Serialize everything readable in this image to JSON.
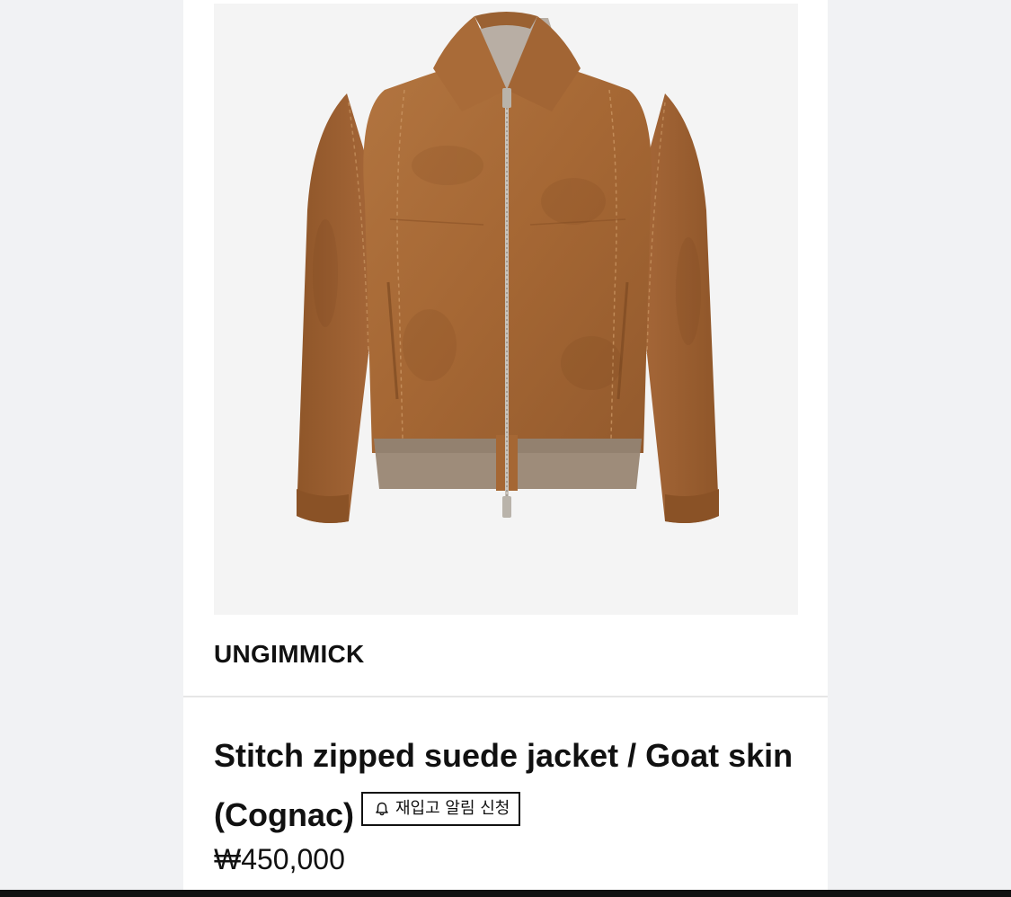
{
  "product": {
    "brand": "UNGIMMICK",
    "title": "Stitch zipped suede jacket / Goat skin (Cognac)",
    "restock_button": {
      "icon": "bell-icon",
      "label": "재입고 알림 신청"
    },
    "price": "₩450,000",
    "image": {
      "subject": "jacket",
      "colors": {
        "suede": "#a86a37",
        "rib": "#9c8a78",
        "background": "#f4f4f4"
      }
    }
  }
}
